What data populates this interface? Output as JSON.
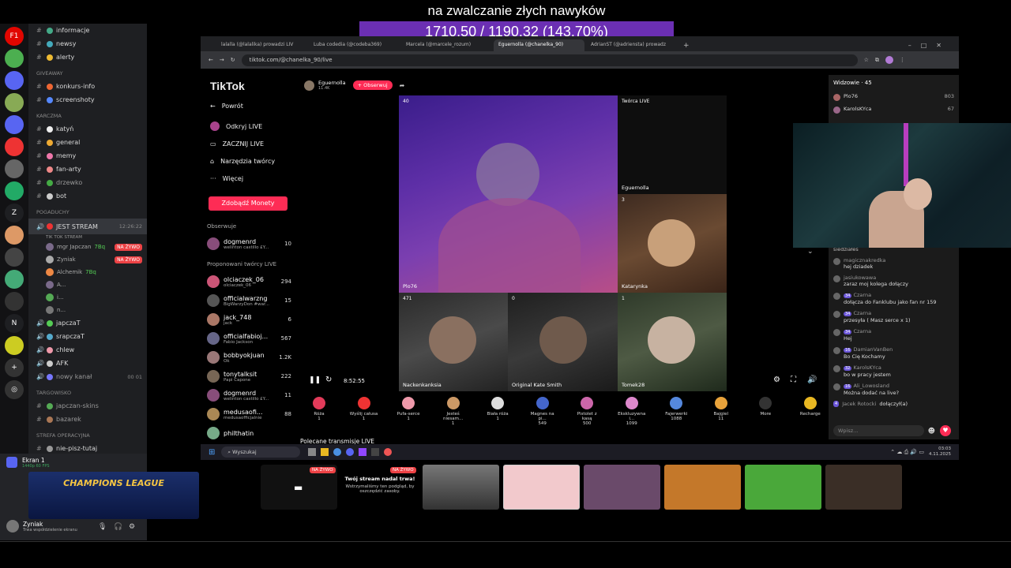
{
  "overlay": {
    "title": "na zwalczanie złych nawyków",
    "stats": "1710.50 / 1190.32 (143.70%)"
  },
  "discord": {
    "servers": [
      "F1",
      "",
      "",
      "",
      "",
      "",
      "",
      "",
      "",
      "",
      "Z",
      "",
      "",
      "",
      "",
      "",
      "N",
      "",
      "",
      ""
    ],
    "channels": {
      "top": [
        {
          "name": "informacje",
          "color": "#4a8"
        },
        {
          "name": "newsy",
          "color": "#4ab"
        },
        {
          "name": "alerty",
          "color": "#eb3"
        }
      ],
      "giveaway_label": "GIVEAWAY",
      "giveaway": [
        {
          "name": "konkurs-info",
          "color": "#e63"
        },
        {
          "name": "screenshoty",
          "color": "#58f"
        }
      ],
      "karczma_label": "KARCZMA",
      "karczma": [
        {
          "name": "katyń",
          "color": "#eee"
        },
        {
          "name": "general",
          "color": "#ea3"
        },
        {
          "name": "memy",
          "color": "#e7a"
        },
        {
          "name": "fan-arty",
          "color": "#e88"
        },
        {
          "name": "drzewko",
          "color": "#4a4"
        },
        {
          "name": "bot",
          "color": "#ccc"
        }
      ],
      "pogaduchy_label": "POGADUCHY",
      "jest_stream": "JEST STREAM",
      "jest_stream_time": "12:26:22",
      "tiktok_stream": "TIK TOK STREAM",
      "voice_users": [
        {
          "name": "mgr Japczan",
          "tag": "7Bq",
          "live": "NA ŻYWO"
        },
        {
          "name": "Zyniak",
          "tag": "",
          "live": "NA ŻYWO"
        },
        {
          "name": "Alchemik",
          "tag": "7Bq",
          "live": ""
        },
        {
          "name": "A...",
          "tag": "",
          "live": ""
        },
        {
          "name": "i...",
          "tag": "",
          "live": ""
        },
        {
          "name": "n...",
          "tag": "",
          "live": ""
        }
      ],
      "voice_channels": [
        {
          "name": "japczaT",
          "badge": ""
        },
        {
          "name": "srapczaT",
          "badge": ""
        },
        {
          "name": "chlew",
          "badge": ""
        },
        {
          "name": "AFK",
          "badge": ""
        },
        {
          "name": "nowy kanał",
          "badge": "00 01"
        }
      ],
      "targowisko_label": "TARGOWISKO",
      "targowisko": [
        {
          "name": "japczan-skins"
        },
        {
          "name": "bazarek"
        }
      ],
      "strefa_label": "STREFA OPERACYJNA",
      "strefa": [
        {
          "name": "nie-pisz-tutaj"
        }
      ]
    },
    "screen_share": {
      "title": "Ekran 1",
      "subtitle": "1440p 60 FPS",
      "banner": "CHAMPIONS LEAGUE"
    },
    "user": {
      "name": "Zyniak",
      "status": "Trwa współdzielenie ekranu"
    }
  },
  "browser": {
    "tabs": [
      "lalalla (@lalalika) prowadzi LIV",
      "Luba codedia (@codeba369)",
      "Marcela (@marcele_rozum)",
      "Eguernolla (@chanelka_90)",
      "AdrianST (@adriensta) prowadz"
    ],
    "url": "tiktok.com/@chanelka_90/live"
  },
  "tiktok": {
    "logo": "TikTok",
    "back": "Powrót",
    "nav": [
      "Odkryj LIVE",
      "ZACZNIJ LIVE",
      "Narzędzia twórcy",
      "Więcej"
    ],
    "coins_button": "Zdobądź Monety",
    "observed_label": "Obserwuje",
    "observed": [
      {
        "name": "dogmenrd",
        "sub": "welinton castillo £Y...",
        "count": "10"
      }
    ],
    "proposed_label": "Proponowani twórcy LIVE",
    "proposed": [
      {
        "name": "olciaczek_06",
        "sub": "olciaczek_06",
        "count": "294"
      },
      {
        "name": "officialwarzng",
        "sub": "BigWarzyDon #war...",
        "count": "15"
      },
      {
        "name": "jack_748",
        "sub": "jack",
        "count": "6"
      },
      {
        "name": "officialfabioj...",
        "sub": "Fabio Jackson",
        "count": "567"
      },
      {
        "name": "bobbyokjuan",
        "sub": "Ok",
        "count": "1.2K"
      },
      {
        "name": "tonytalksit",
        "sub": "Papi Capone",
        "count": "222"
      },
      {
        "name": "dogmenrd",
        "sub": "welinton castillo £Y...",
        "count": "11"
      },
      {
        "name": "medusaofi...",
        "sub": "medusaofficjalnie",
        "count": "88"
      },
      {
        "name": "philthatin",
        "sub": "",
        "count": ""
      }
    ],
    "host": {
      "name": "Eguernolla",
      "sub": "11.4K",
      "follow": "+ Obserwuj"
    },
    "tiles": [
      {
        "name": "Plo76",
        "count": "40"
      },
      {
        "name": "Twórca LIVE",
        "count": ""
      },
      {
        "name": "Katarynka",
        "count": "3"
      },
      {
        "name": "Nackenkanksia",
        "count": "471"
      },
      {
        "name": "Original Kate Smith",
        "count": "0"
      },
      {
        "name": "Tomek28",
        "count": "1"
      }
    ],
    "host_tag": "Eguernolla",
    "time": "8:52:55",
    "gifts": [
      {
        "name": "Róża",
        "price": "1",
        "color": "#e23b5a"
      },
      {
        "name": "Wyślij całusa",
        "price": "1",
        "color": "#e33"
      },
      {
        "name": "Pufa-serce",
        "price": "1",
        "color": "#e9a"
      },
      {
        "name": "Jesteś niesam...",
        "price": "1",
        "color": "#c96"
      },
      {
        "name": "Biała róża",
        "price": "1",
        "color": "#ddd"
      },
      {
        "name": "Magnes na pi...",
        "price": "549",
        "color": "#46c"
      },
      {
        "name": "Pistolet z kasą",
        "price": "500",
        "color": "#c6a"
      },
      {
        "name": "Ekskluzywna i...",
        "price": "1099",
        "color": "#d8c"
      },
      {
        "name": "Fajerwerki",
        "price": "1088",
        "color": "#58d"
      },
      {
        "name": "Bajgiel",
        "price": "11",
        "color": "#e9a33b"
      },
      {
        "name": "More",
        "price": "",
        "color": "#333"
      },
      {
        "name": "Recharge",
        "price": "",
        "color": "#e9b822"
      }
    ],
    "recommended": "Polecane transmisje LIVE",
    "viewers_label": "Widzowie · 45",
    "viewers": [
      {
        "name": "Plo76",
        "count": "803"
      },
      {
        "name": "KarolsKYca",
        "count": "67"
      }
    ],
    "chat": [
      {
        "user": "",
        "text": "siedziałeś",
        "level": ""
      },
      {
        "user": "magicznakredka",
        "text": "hej dziadek",
        "level": ""
      },
      {
        "user": "jasiukowawa",
        "text": "zaraz moj kolega dołączy",
        "level": ""
      },
      {
        "user": "Czarna",
        "text": "dołącza do Fanklubu jako fan nr 159",
        "level": "34"
      },
      {
        "user": "Czarna",
        "text": "przesyła ( Masz serce x 1)",
        "level": "34"
      },
      {
        "user": "Czarna",
        "text": "Hej",
        "level": "34"
      },
      {
        "user": "DamianVanBen",
        "text": "Bo Cię Kochamy",
        "level": "16"
      },
      {
        "user": "KarolsKYca",
        "text": "bo w pracy jestem",
        "level": "32"
      },
      {
        "user": "Ali_Lowosland",
        "text": "Można dodać na live?",
        "level": "16"
      },
      {
        "user": "Jacek Rotocki",
        "text": "dołączył(a)",
        "level": "4"
      }
    ],
    "chat_input": "Wpisz..."
  },
  "taskbar": {
    "search": "Wyszukaj",
    "time": "03:03",
    "date": "4.11.2025"
  },
  "strip": {
    "live_badge": "NA ŻYWO",
    "notice_title": "Twój stream nadal trwa!",
    "notice_body": "Wstrzymaliśmy ten podgląd, by oszczędzić zasoby."
  }
}
